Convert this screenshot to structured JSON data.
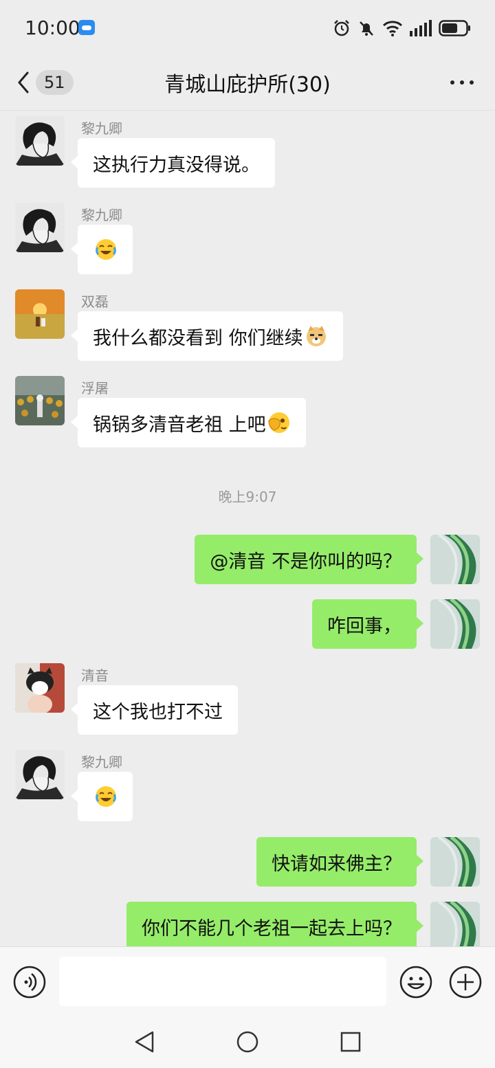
{
  "status_bar": {
    "time": "10:00"
  },
  "header": {
    "unread_count": "51",
    "title": "青城山庇护所(30)"
  },
  "messages": [
    {
      "sender": "黎九卿",
      "text": "这执行力真没得说。",
      "emoji": ""
    },
    {
      "sender": "黎九卿",
      "text": "",
      "emoji": "laughing-crying"
    },
    {
      "sender": "双磊",
      "text": "我什么都没看到 你们继续",
      "emoji": "doge"
    },
    {
      "sender": "浮屠",
      "text": "锅锅多清音老祖 上吧",
      "emoji": "face-palm"
    },
    {
      "timestamp": "晚上9:07"
    },
    {
      "sender": "me",
      "text": "@清音  不是你叫的吗？"
    },
    {
      "sender": "me",
      "text": "咋回事，"
    },
    {
      "sender": "清音",
      "text": "这个我也打不过",
      "emoji": ""
    },
    {
      "sender": "黎九卿",
      "text": "",
      "emoji": "laughing-crying"
    },
    {
      "sender": "me",
      "text": "快请如来佛主？"
    },
    {
      "sender": "me",
      "text": "你们不能几个老祖一起去上吗？"
    }
  ],
  "colors": {
    "background": "#ededed",
    "incoming_bubble": "#ffffff",
    "outgoing_bubble": "#95ec69",
    "name_text": "#8c8c8c"
  },
  "icons": {
    "back": "chevron-left-icon",
    "more": "more-dots-icon",
    "voice": "voice-icon",
    "emoji": "emoji-icon",
    "plus": "plus-icon",
    "nav_back": "triangle-back-icon",
    "nav_home": "circle-home-icon",
    "nav_recent": "square-recent-icon"
  }
}
